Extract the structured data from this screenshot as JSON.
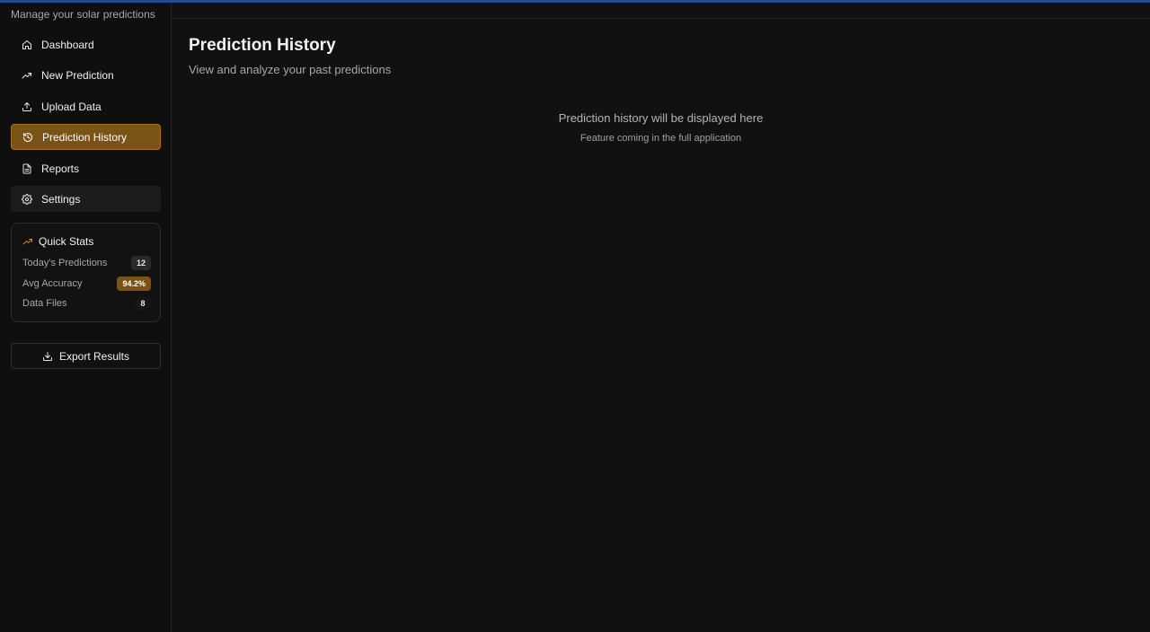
{
  "sidebar": {
    "subtitle": "Manage your solar predictions",
    "nav": [
      {
        "label": "Dashboard",
        "icon": "home-icon"
      },
      {
        "label": "New Prediction",
        "icon": "trending-up-icon"
      },
      {
        "label": "Upload Data",
        "icon": "upload-icon"
      },
      {
        "label": "Prediction History",
        "icon": "history-icon",
        "active": true
      },
      {
        "label": "Reports",
        "icon": "file-text-icon"
      },
      {
        "label": "Settings",
        "icon": "gear-icon"
      }
    ],
    "quick_stats": {
      "title": "Quick Stats",
      "icon": "trending-up-icon",
      "rows": [
        {
          "label": "Today's Predictions",
          "value": "12"
        },
        {
          "label": "Avg Accuracy",
          "value": "94.2%"
        },
        {
          "label": "Data Files",
          "value": "8"
        }
      ]
    },
    "export_label": "Export Results"
  },
  "main": {
    "title": "Prediction History",
    "subtitle": "View and analyze your past predictions",
    "empty_title": "Prediction history will be displayed here",
    "empty_subtitle": "Feature coming in the full application"
  },
  "colors": {
    "accent_gold": "#7b5316",
    "top_bar_blue": "#1e4e8c",
    "background": "#111111"
  }
}
